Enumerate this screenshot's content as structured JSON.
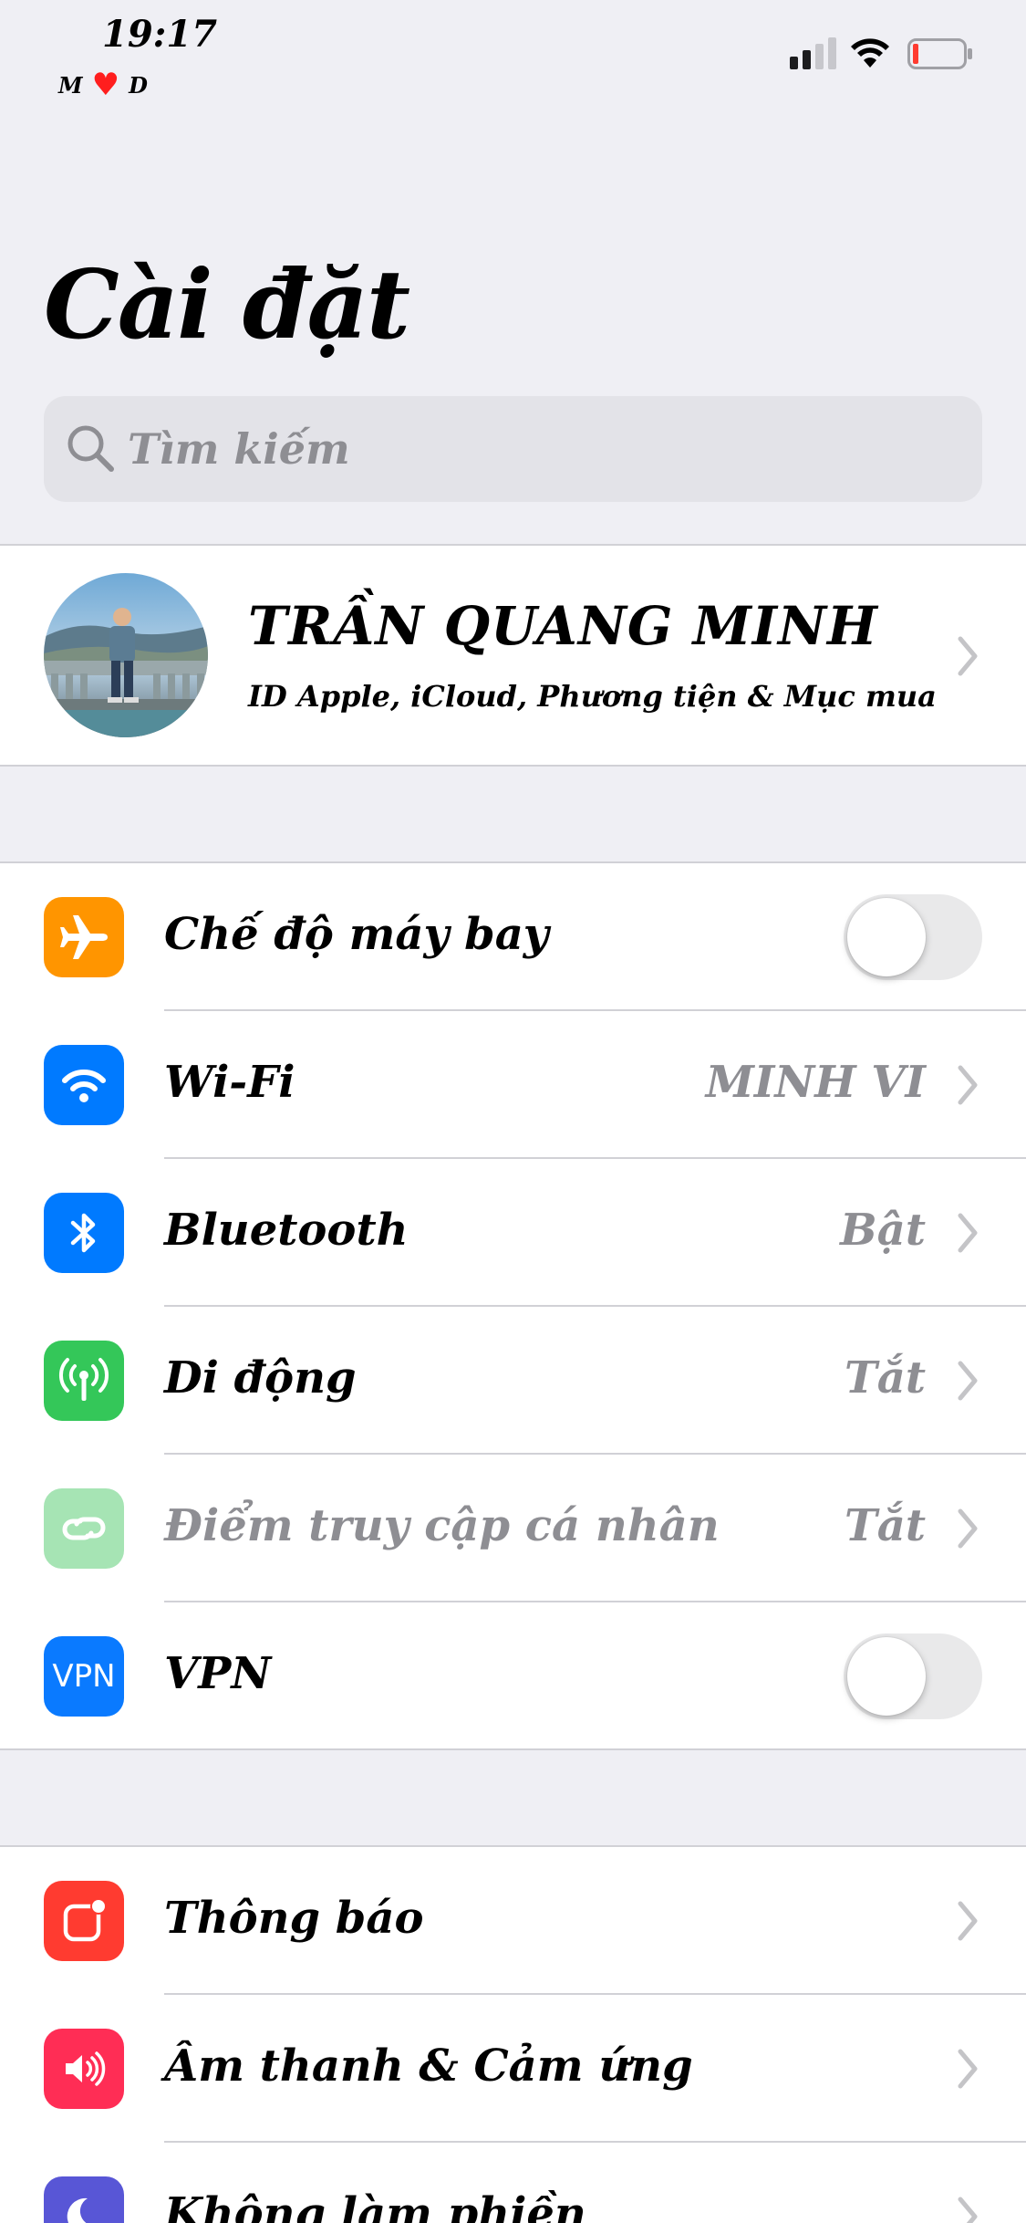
{
  "status_bar": {
    "time": "19:17",
    "badge_left": "M",
    "badge_right": "D",
    "battery_color": "#ff3b30"
  },
  "title": "Cài đặt",
  "search": {
    "placeholder": "Tìm kiếm"
  },
  "profile": {
    "name": "TRẦN QUANG MINH",
    "subtitle": "ID Apple, iCloud, Phương tiện & Mục mua"
  },
  "group1": [
    {
      "label": "Chế độ máy bay",
      "control": "toggle",
      "on": false,
      "icon": "airplane-icon",
      "color": "#ff9500"
    },
    {
      "label": "Wi-Fi",
      "value": "MINH VI",
      "icon": "wifi-icon",
      "color": "#007aff"
    },
    {
      "label": "Bluetooth",
      "value": "Bật",
      "icon": "bluetooth-icon",
      "color": "#007aff"
    },
    {
      "label": "Di động",
      "value": "Tắt",
      "icon": "cellular-icon",
      "color": "#34c759"
    },
    {
      "label": "Điểm truy cập cá nhân",
      "value": "Tắt",
      "icon": "hotspot-icon",
      "color": "#a6e4b4",
      "disabled": true
    },
    {
      "label": "VPN",
      "icon_text": "VPN",
      "control": "toggle",
      "on": false,
      "icon": "vpn-icon",
      "color": "#0a7aff"
    }
  ],
  "group2": [
    {
      "label": "Thông báo",
      "icon": "notifications-icon",
      "color": "#ff3b30"
    },
    {
      "label": "Âm thanh & Cảm ứng",
      "icon": "sound-icon",
      "color": "#ff2d55"
    },
    {
      "label": "Không làm phiền",
      "icon": "moon-icon",
      "color": "#5856d6"
    }
  ]
}
